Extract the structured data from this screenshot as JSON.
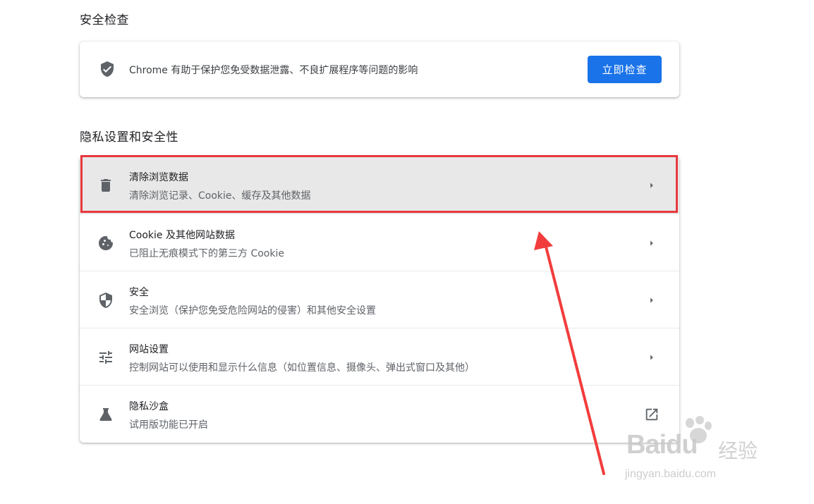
{
  "safety_check": {
    "section_title": "安全检查",
    "description": "Chrome 有助于保护您免受数据泄露、不良扩展程序等问题的影响",
    "button_label": "立即检查"
  },
  "privacy": {
    "section_title": "隐私设置和安全性",
    "rows": [
      {
        "title": "清除浏览数据",
        "subtitle": "清除浏览记录、Cookie、缓存及其他数据",
        "icon": "trash-icon",
        "action": "chevron-right-icon"
      },
      {
        "title": "Cookie 及其他网站数据",
        "subtitle": "已阻止无痕模式下的第三方 Cookie",
        "icon": "cookie-icon",
        "action": "chevron-right-icon"
      },
      {
        "title": "安全",
        "subtitle": "安全浏览（保护您免受危险网站的侵害）和其他安全设置",
        "icon": "shield-half-icon",
        "action": "chevron-right-icon"
      },
      {
        "title": "网站设置",
        "subtitle": "控制网站可以使用和显示什么信息（如位置信息、摄像头、弹出式窗口及其他）",
        "icon": "tune-icon",
        "action": "chevron-right-icon"
      },
      {
        "title": "隐私沙盒",
        "subtitle": "试用版功能已开启",
        "icon": "flask-icon",
        "action": "open-in-new-icon"
      }
    ]
  },
  "watermark": {
    "brand": "Baidu",
    "brand_cn": "经验",
    "url": "jingyan.baidu.com"
  },
  "colors": {
    "accent": "#1a73e8",
    "highlight_border": "#e8383d",
    "row_highlight": "#e8e8e8",
    "icon": "#5f6368"
  }
}
